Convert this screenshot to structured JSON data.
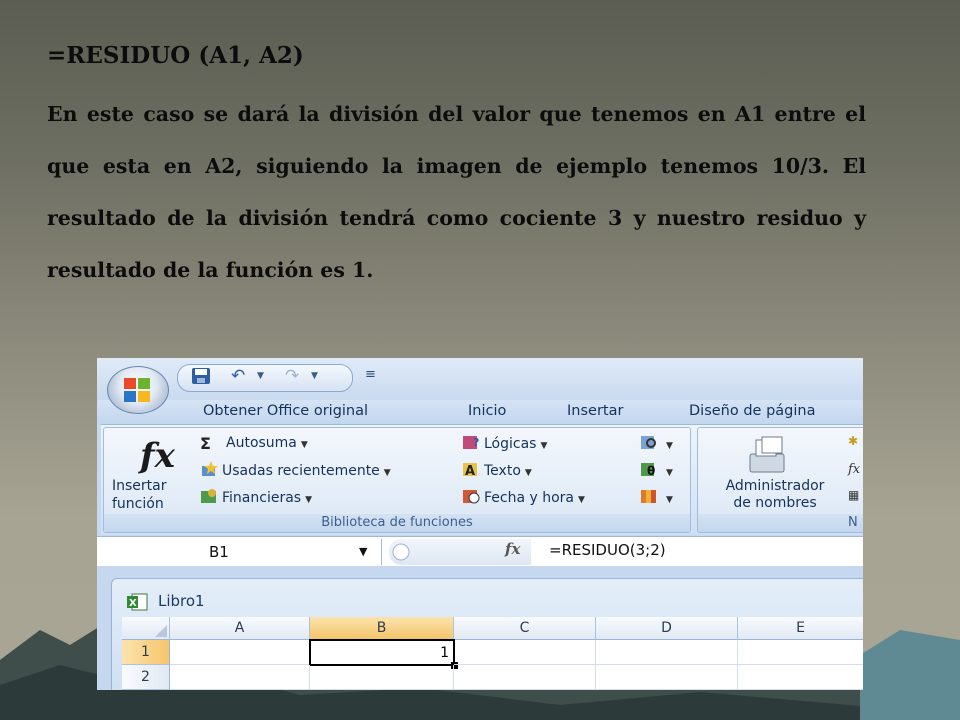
{
  "slide": {
    "title": "=RESIDUO (A1, A2)",
    "paragraph": "En este caso se dará la división del valor que tenemos en A1 entre el que esta en A2, siguiendo la imagen de ejemplo tenemos 10/3. El resultado de la división tendrá como cociente 3 y nuestro residuo y resultado de la función es 1."
  },
  "excel": {
    "tabs": [
      "Obtener Office original",
      "Inicio",
      "Insertar",
      "Diseño de página"
    ],
    "group_functions": {
      "insert_label_line1": "Insertar",
      "insert_label_line2": "función",
      "autosum": "Autosuma",
      "recent": "Usadas recientemente",
      "financial": "Financieras",
      "logical": "Lógicas",
      "text": "Texto",
      "datetime": "Fecha y hora",
      "label": "Biblioteca de funciones"
    },
    "group_names": {
      "admin_line1": "Administrador",
      "admin_line2": "de nombres",
      "label_partial": "N"
    },
    "name_box": "B1",
    "fx_label": "fx",
    "formula": "=RESIDUO(3;2)",
    "workbook_title": "Libro1",
    "columns": [
      "A",
      "B",
      "C",
      "D",
      "E"
    ],
    "rows": [
      "1",
      "2"
    ],
    "cell_b1_value": "1",
    "colors": {
      "ribbon": "#dce8f6",
      "selected_header": "#f6c56b",
      "slide_bg": "#8d8b7c"
    }
  }
}
